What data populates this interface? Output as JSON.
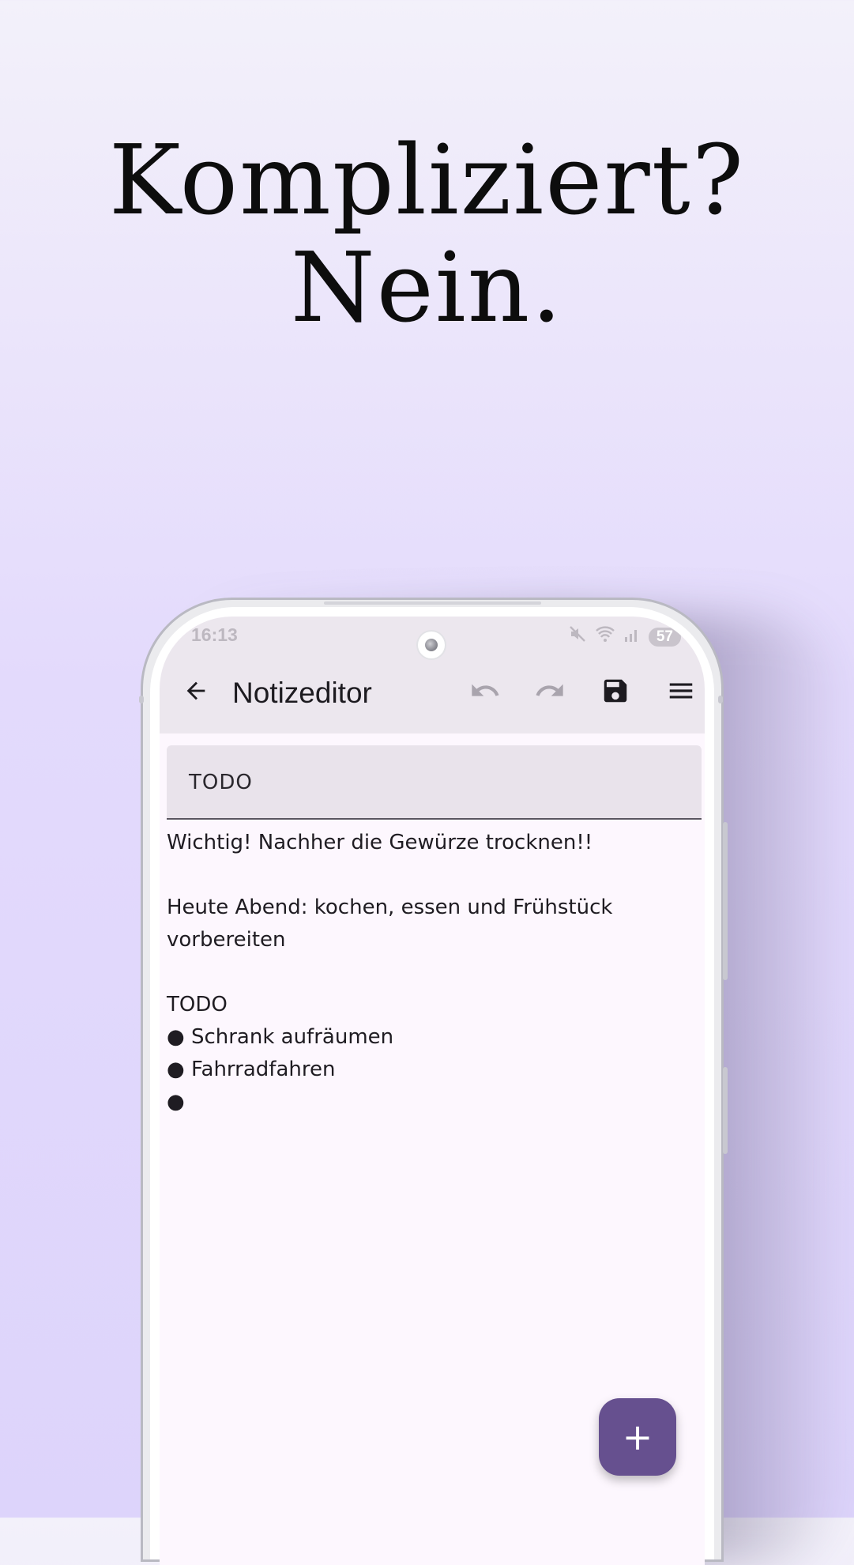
{
  "headline": {
    "line1": "Kompliziert?",
    "line2": "Nein."
  },
  "statusbar": {
    "time": "16:13",
    "battery": "57",
    "mute_icon": "mute-icon",
    "wifi_icon": "wifi-icon",
    "signal_icon": "signal-icon"
  },
  "appbar": {
    "title": "Notizeditor",
    "back_icon": "arrow-back-icon",
    "undo_icon": "undo-icon",
    "redo_icon": "redo-icon",
    "save_icon": "save-icon",
    "menu_icon": "menu-icon"
  },
  "note": {
    "title": "TODO",
    "lines": [
      "Wichtig! Nachher die Gewürze trocknen!!",
      "",
      "Heute Abend: kochen, essen und Frühstück",
      "vorbereiten",
      "",
      "TODO",
      "● Schrank aufräumen",
      "● Fahrradfahren",
      "●"
    ]
  },
  "fab": {
    "label": "+"
  },
  "colors": {
    "accent": "#66508f",
    "appbar": "#ece7ee",
    "background": "#fdf7fe"
  }
}
